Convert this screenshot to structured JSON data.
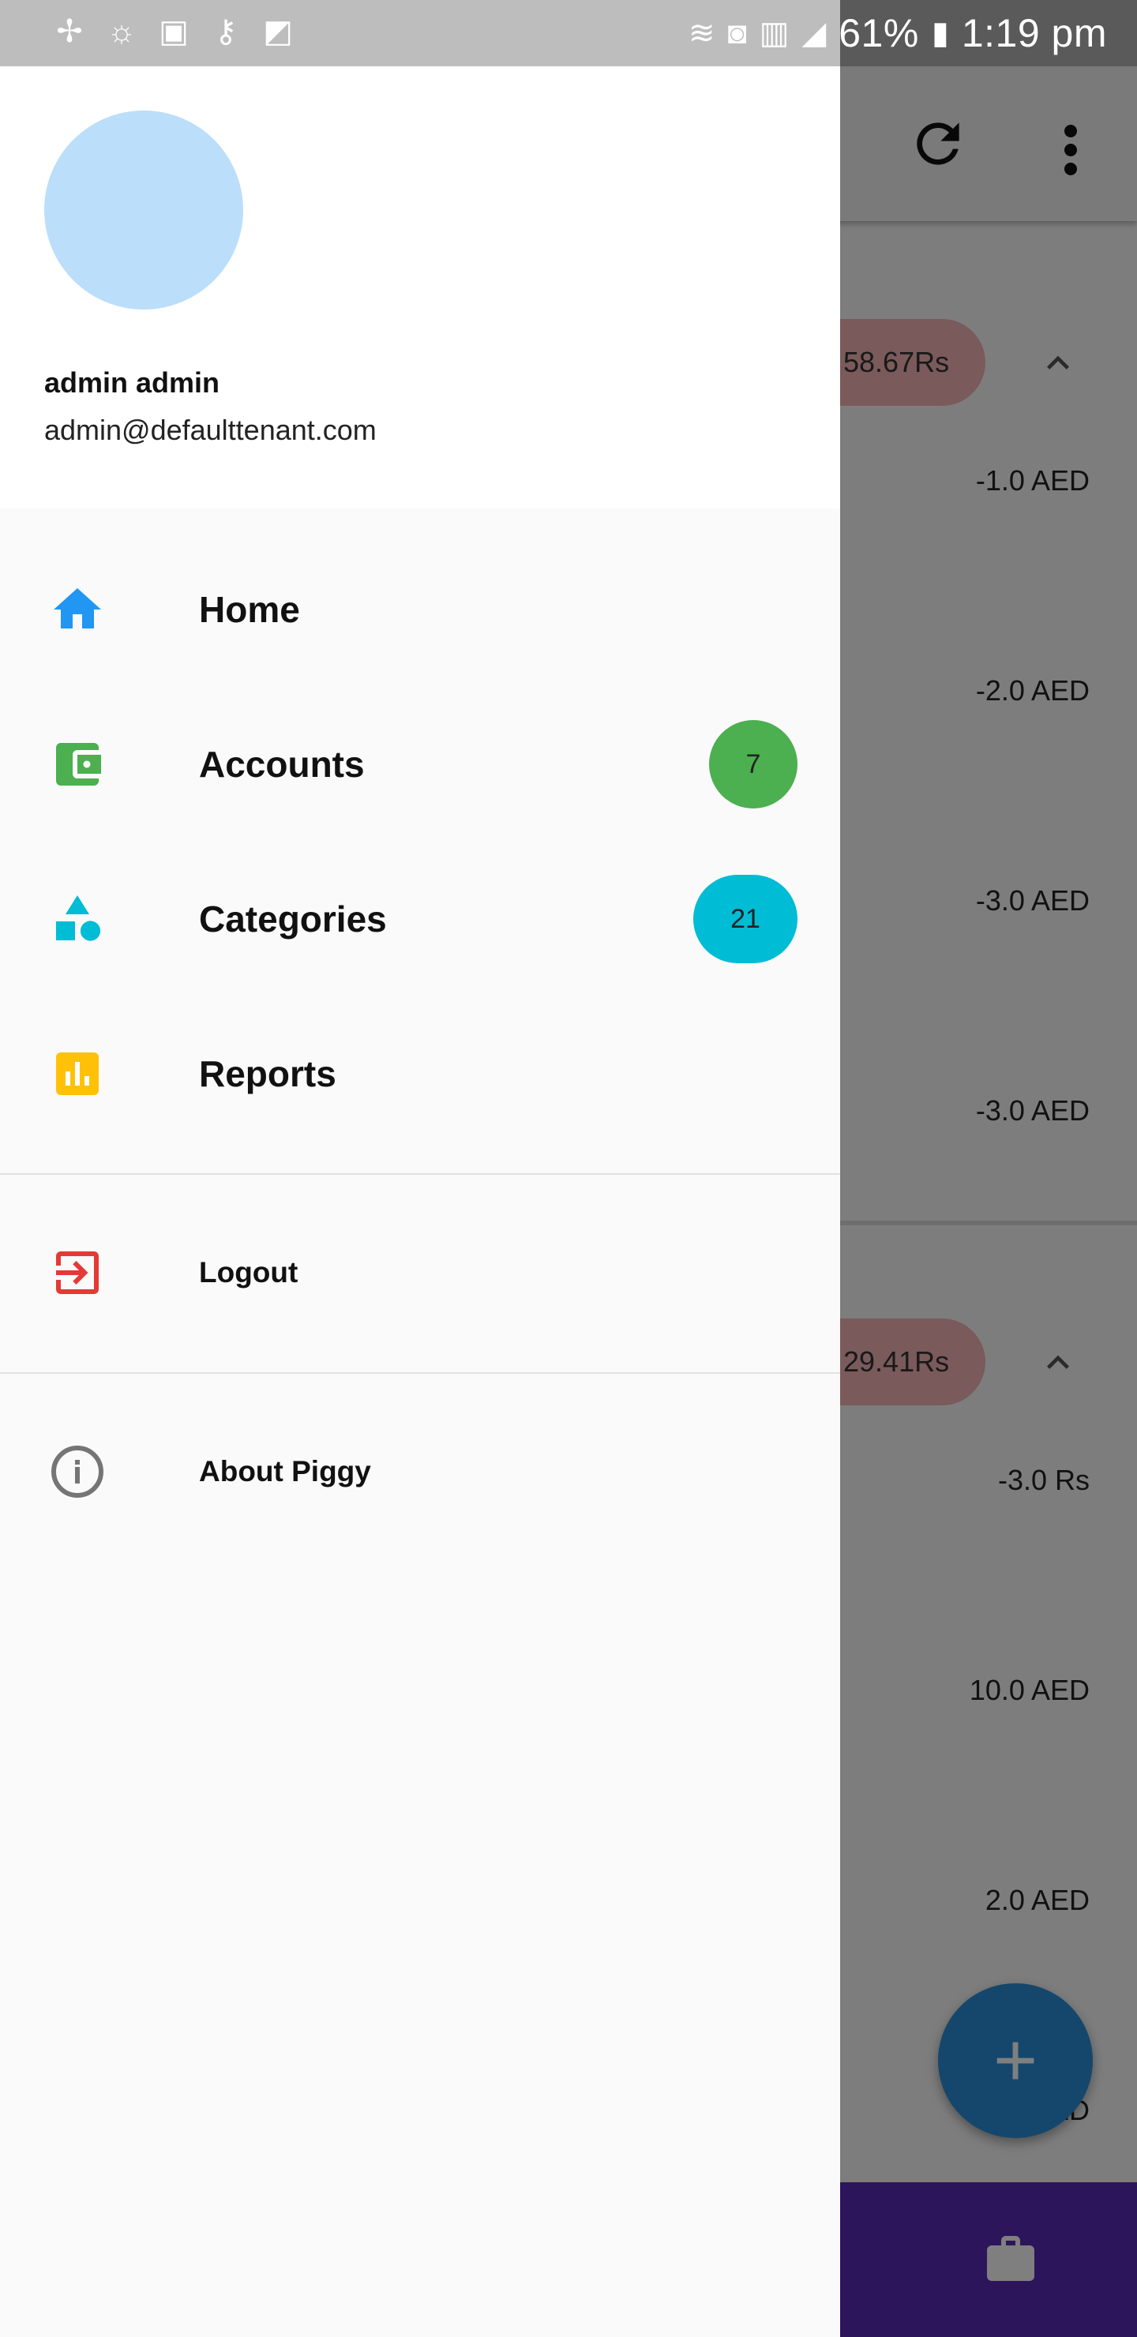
{
  "status_bar": {
    "battery": "61%",
    "time": "1:19 pm",
    "left_icons": [
      "pinwheel-icon",
      "weather-icon",
      "image-icon",
      "key-icon",
      "activity-icon"
    ],
    "right_icons": [
      "wifi-icon",
      "nfc-icon",
      "signal-icon",
      "signal-icon-2",
      "battery-icon"
    ]
  },
  "background_app": {
    "toolbar_icons": [
      "refresh-icon",
      "more-vert-icon"
    ],
    "groups": [
      {
        "total": "58.67Rs",
        "amounts": [
          "-1.0 AED",
          "-2.0 AED",
          "-3.0 AED",
          "-3.0 AED"
        ]
      },
      {
        "total": "29.41Rs",
        "amounts": [
          "-3.0 Rs",
          "10.0 AED",
          "2.0 AED",
          "ED"
        ]
      }
    ],
    "fab_label": "+",
    "bottom_icon": "briefcase-icon"
  },
  "drawer": {
    "user": {
      "name": "admin admin",
      "email": "admin@defaulttenant.com"
    },
    "items": [
      {
        "label": "Home",
        "icon": "home-icon",
        "color": "#2196F3"
      },
      {
        "label": "Accounts",
        "icon": "wallet-icon",
        "color": "#4CAF50",
        "badge": "7",
        "badge_color": "#4CAF50"
      },
      {
        "label": "Categories",
        "icon": "shapes-icon",
        "color": "#00BCD4",
        "badge": "21",
        "badge_color": "#00BCD4"
      },
      {
        "label": "Reports",
        "icon": "bar-chart-icon",
        "color": "#FFC107"
      }
    ],
    "secondary": [
      {
        "label": "Logout",
        "icon": "logout-icon",
        "color": "#E53935"
      },
      {
        "label": "About Piggy",
        "icon": "info-icon",
        "color": "#757575"
      }
    ]
  }
}
